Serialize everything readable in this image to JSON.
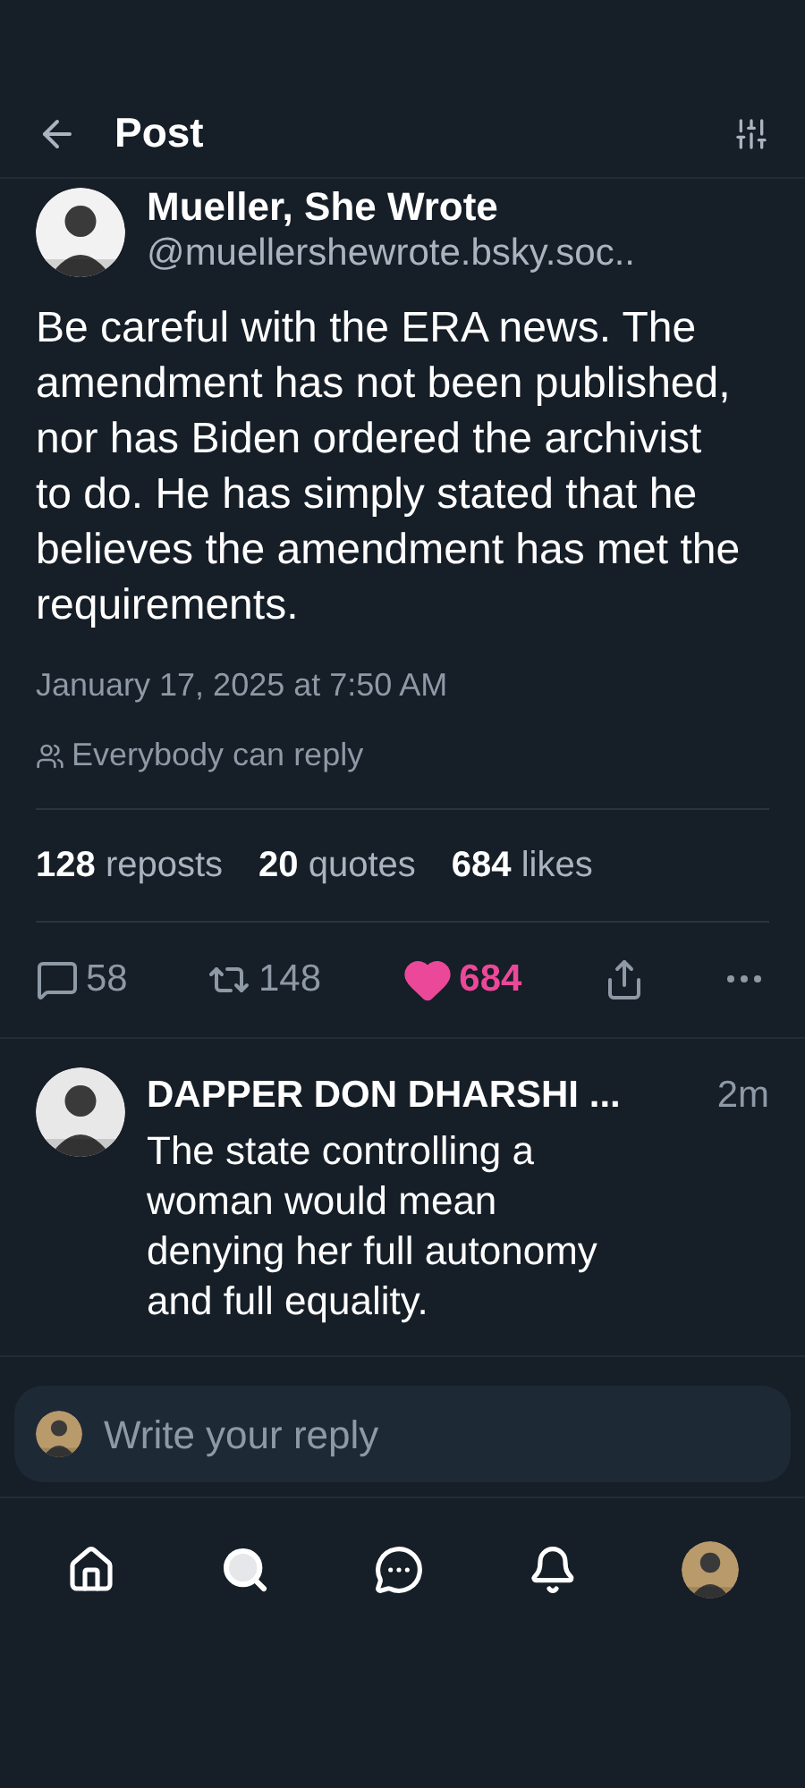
{
  "header": {
    "title": "Post"
  },
  "post": {
    "author": "Mueller, She Wrote",
    "handle": "@muellershewrote.bsky.soc..",
    "text": "Be careful with the ERA news. The amendment has not been published, nor has Biden ordered the archivist to do. He has simply stated that he believes the amendment has met the requirements.",
    "timestamp": "January 17, 2025 at 7:50 AM",
    "reply_setting": "Everybody can reply",
    "stats": [
      {
        "count": "128",
        "label": "reposts"
      },
      {
        "count": "20",
        "label": "quotes"
      },
      {
        "count": "684",
        "label": "likes"
      }
    ],
    "actions": {
      "replies": "58",
      "reposts": "148",
      "likes": "684",
      "liked": true
    }
  },
  "replies": [
    {
      "author": "DAPPER DON DHARSHI ...",
      "time": "2m",
      "text": "The state controlling a woman would mean denying her full autonomy and full equality."
    }
  ],
  "composer": {
    "placeholder": "Write your reply"
  },
  "nav": [
    {
      "kind": "home",
      "selected": false
    },
    {
      "kind": "search",
      "selected": true
    },
    {
      "kind": "chat",
      "selected": false
    },
    {
      "kind": "bell",
      "selected": false
    },
    {
      "kind": "avatar",
      "selected": false
    }
  ]
}
